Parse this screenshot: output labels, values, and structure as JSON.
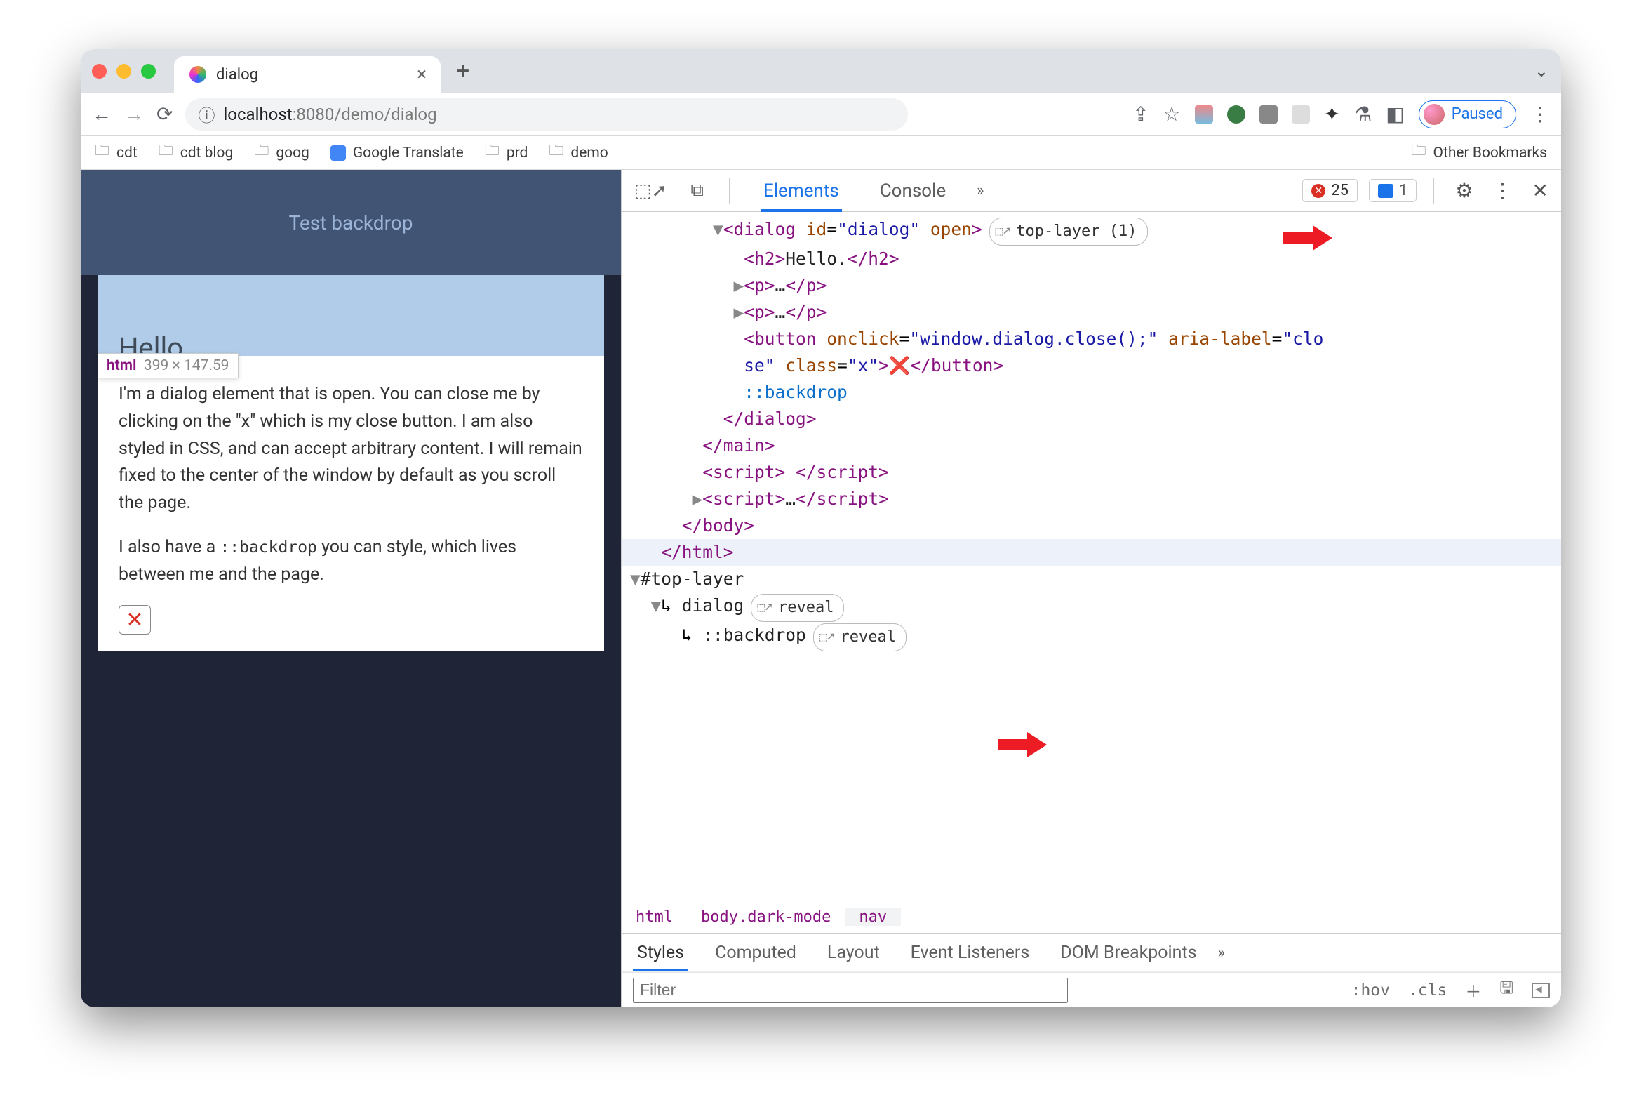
{
  "tab": {
    "title": "dialog"
  },
  "url": {
    "prefix": "localhost",
    "port": ":8080",
    "path": "/demo/dialog"
  },
  "profile": {
    "label": "Paused"
  },
  "bookmarks": [
    "cdt",
    "cdt blog",
    "goog",
    "Google Translate",
    "prd",
    "demo"
  ],
  "bookmarks_other": "Other Bookmarks",
  "page": {
    "header": "Test backdrop",
    "h2": "Hello.",
    "tooltip_tag": "html",
    "tooltip_dims": "399 × 147.59",
    "p1": "I'm a dialog element that is open. You can close me by clicking on the \"x\" which is my close button. I am also styled in CSS, and can accept arbitrary content. I will remain fixed to the center of the window by default as you scroll the page.",
    "p2a": "I also have a ",
    "p2b": "::backdrop",
    "p2c": " you can style, which lives between me and the page.",
    "xbtn": "✕"
  },
  "devtools": {
    "tabs": {
      "elements": "Elements",
      "console": "Console"
    },
    "errors": "25",
    "messages": "1",
    "top_layer_badge": "top-layer (1)",
    "reveal": "reveal",
    "crumbs": [
      "html",
      "body.dark-mode",
      "nav"
    ],
    "style_tabs": [
      "Styles",
      "Computed",
      "Layout",
      "Event Listeners",
      "DOM Breakpoints"
    ],
    "filter_placeholder": "Filter",
    "hov": ":hov",
    "cls": ".cls"
  },
  "dom": {
    "l1a": "<dialog ",
    "l1_id_n": "id",
    "l1_id_v": "\"dialog\"",
    "l1_open": " open",
    "l1b": ">",
    "l2": "<h2>",
    "l2t": "Hello.",
    "l2c": "</h2>",
    "l3": "<p>",
    "l3t": "…",
    "l3c": "</p>",
    "l4": "<p>",
    "l4t": "…",
    "l4c": "</p>",
    "btn_open": "<button ",
    "btn_onclick_n": "onclick",
    "btn_onclick_v": "\"window.dialog.close();\"",
    "btn_aria_n": "aria-label",
    "btn_aria_v": "\"close\"",
    "btn_class_n": "class",
    "btn_class_v": "\"x\"",
    "btn_gt": ">",
    "btn_x": "❌",
    "btn_close": "</button>",
    "backdrop": "::backdrop",
    "dialog_close": "</dialog>",
    "main_close": "</main>",
    "script_e": "<script> </script>",
    "script_c": "<script>",
    "script_ct": "…",
    "script_cc": "</script>",
    "body_close": "</body>",
    "html_close": "</html>",
    "toplayer": "#top-layer",
    "tl_dialog": "dialog",
    "tl_backdrop": "::backdrop"
  }
}
